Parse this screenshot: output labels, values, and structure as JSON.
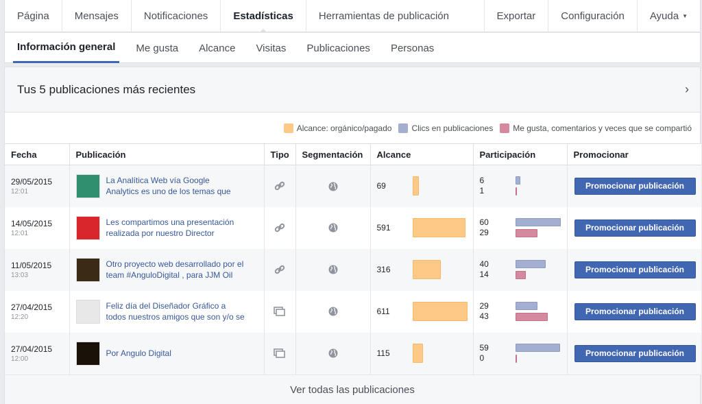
{
  "topnav": {
    "items": [
      "Página",
      "Mensajes",
      "Notificaciones",
      "Estadísticas",
      "Herramientas de publicación"
    ],
    "export": "Exportar",
    "config": "Configuración",
    "help": "Ayuda",
    "help_caret": "▼"
  },
  "subnav": {
    "tabs": [
      "Información general",
      "Me gusta",
      "Alcance",
      "Visitas",
      "Publicaciones",
      "Personas"
    ]
  },
  "panel": {
    "title": "Tus 5 publicaciones más recientes",
    "chevron": "›",
    "legend": [
      {
        "label": "Alcance: orgánico/pagado",
        "color": "#fdc986"
      },
      {
        "label": "Clics en publicaciones",
        "color": "#a3aed1"
      },
      {
        "label": "Me gusta, comentarios y veces que se compartió",
        "color": "#d4899e"
      }
    ],
    "columns": [
      "Fecha",
      "Publicación",
      "Tipo",
      "Segmentación",
      "Alcance",
      "Participación",
      "Promocionar"
    ],
    "rows": [
      {
        "date": "29/05/2015",
        "time": "12:01",
        "text1": "La Analítica Web vía Google",
        "text2": "Analytics es uno de los temas que",
        "type": "link",
        "reach": 69,
        "clicks": 6,
        "likes": 1,
        "button": "Promocionar publicación",
        "thumb_color": "#2f8f6f"
      },
      {
        "date": "14/05/2015",
        "time": "12:01",
        "text1": "Les compartimos una presentación",
        "text2": "realizada por nuestro Director",
        "type": "link",
        "reach": 591,
        "clicks": 60,
        "likes": 29,
        "button": "Promocionar publicación",
        "thumb_color": "#d9262c"
      },
      {
        "date": "11/05/2015",
        "time": "13:03",
        "text1": "Otro proyecto web desarrollado por el",
        "text2": "team #AnguloDigital , para JJM Oil",
        "type": "link",
        "reach": 316,
        "clicks": 40,
        "likes": 14,
        "button": "Promocionar publicación",
        "thumb_color": "#3a2a16"
      },
      {
        "date": "27/04/2015",
        "time": "12:20",
        "text1": "Feliz día del Diseñador Gráfico a",
        "text2": "todos nuestros amigos que son y/o se",
        "type": "album",
        "reach": 611,
        "clicks": 29,
        "likes": 43,
        "button": "Promocionar publicación",
        "thumb_color": "#e8e8e8"
      },
      {
        "date": "27/04/2015",
        "time": "12:00",
        "text1": "Por Angulo Digital",
        "text2": "",
        "type": "album",
        "reach": 115,
        "clicks": 59,
        "likes": 0,
        "button": "Promocionar publicación",
        "thumb_color": "#1a1208"
      }
    ],
    "footer": "Ver todas las publicaciones"
  }
}
